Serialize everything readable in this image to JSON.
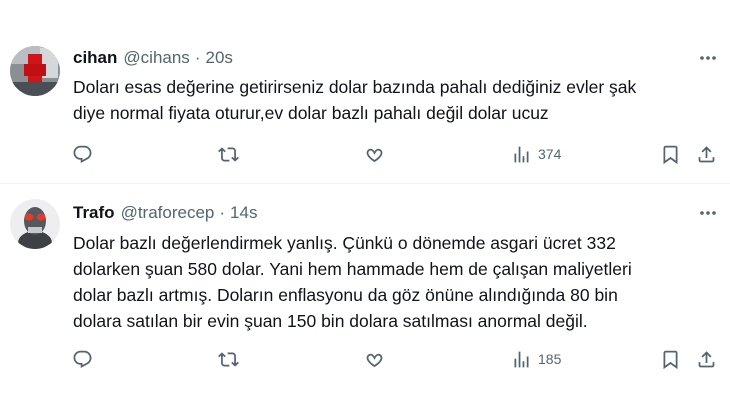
{
  "tweets": [
    {
      "name": "cihan",
      "handle": "@cihans",
      "separator": "·",
      "time": "20s",
      "text_lines": [
        "Doları esas değerine getirirseniz dolar bazında pahalı dediğiniz evler şak",
        "diye normal fiyata oturur,ev dolar bazlı pahalı değil dolar ucuz"
      ],
      "views": "374"
    },
    {
      "name": "Trafo",
      "handle": "@traforecep",
      "separator": "·",
      "time": "14s",
      "text_lines": [
        "Dolar bazlı değerlendirmek yanlış. Çünkü o dönemde asgari ücret 332",
        "dolarken şuan 580 dolar. Yani hem hammade hem de çalışan maliyetleri",
        "dolar bazlı artmış. Doların enflasyonu da göz önüne alındığında 80 bin",
        "dolara satılan bir evin şuan 150 bin dolara satılması anormal değil."
      ],
      "views": "185"
    }
  ],
  "icons": {
    "more": "more-horizontal-icon",
    "reply": "reply-icon",
    "retweet": "retweet-icon",
    "like": "heart-icon",
    "views": "views-chart-icon",
    "bookmark": "bookmark-icon",
    "share": "share-icon"
  },
  "colors": {
    "text_primary": "#0f1419",
    "text_secondary": "#536471",
    "divider": "#eff3f4",
    "background": "#ffffff"
  }
}
